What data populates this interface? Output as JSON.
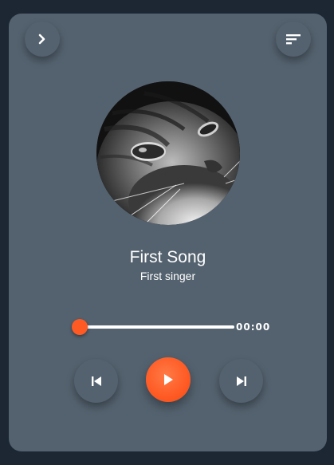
{
  "player": {
    "song_title": "First Song",
    "artist": "First singer",
    "time_display": "00:00",
    "progress": 0
  },
  "controls": {
    "back_icon": "chevron-right-icon",
    "menu_icon": "sort-list-icon",
    "prev_icon": "skip-previous-icon",
    "play_icon": "play-icon",
    "next_icon": "skip-next-icon"
  },
  "album_art": {
    "description_icon": "album-art"
  },
  "colors": {
    "background": "#1c2733",
    "card": "#54626f",
    "accent": "#ff5a24",
    "text": "#ffffff"
  }
}
